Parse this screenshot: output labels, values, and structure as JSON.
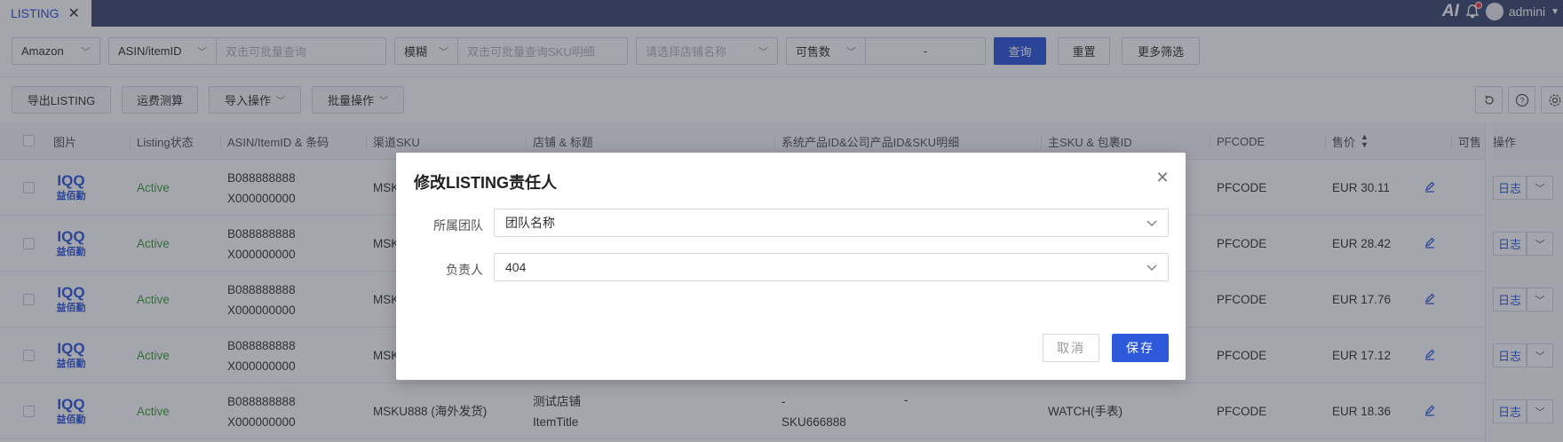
{
  "tabs": {
    "active_label": "LISTING",
    "close_glyph": "✕"
  },
  "header": {
    "ai_label": "AI",
    "username": "admini"
  },
  "filters": {
    "platform": "Amazon",
    "id_type": "ASIN/itemID",
    "id_placeholder": "双击可批量查询",
    "match_mode": "模糊",
    "sku_placeholder": "双击可批量查询SKU明细",
    "shop_placeholder": "请选择店铺名称",
    "qty_type": "可售数",
    "range_sep": "-",
    "search_btn": "查询",
    "reset_btn": "重置",
    "more_btn": "更多筛选"
  },
  "actions": {
    "export": "导出LISTING",
    "freight": "运费测算",
    "import": "导入操作",
    "batch": "批量操作"
  },
  "table": {
    "columns": {
      "image": "图片",
      "status": "Listing状态",
      "asin": "ASIN/ItemID & 条码",
      "sku": "渠道SKU",
      "shop": "店铺 & 标题",
      "sysid": "系统产品ID&公司产品ID&SKU明细",
      "mainsku": "主SKU & 包裹ID",
      "pfcode": "PFCODE",
      "price": "售价",
      "sellable": "可售",
      "ops": "操作"
    },
    "logo_text": "益佰勤",
    "log_label": "日志",
    "rows": [
      {
        "status": "Active",
        "asin": "B088888888",
        "barcode": "X000000000",
        "sku": "MSK",
        "pfcode": "PFCODE",
        "price": "EUR 30.11"
      },
      {
        "status": "Active",
        "asin": "B088888888",
        "barcode": "X000000000",
        "sku": "MSK",
        "pfcode": "PFCODE",
        "price": "EUR 28.42"
      },
      {
        "status": "Active",
        "asin": "B088888888",
        "barcode": "X000000000",
        "sku": "MSK",
        "pfcode": "PFCODE",
        "price": "EUR 17.76"
      },
      {
        "status": "Active",
        "asin": "B088888888",
        "barcode": "X000000000",
        "sku": "MSK",
        "pfcode": "PFCODE",
        "price": "EUR 17.12"
      },
      {
        "status": "Active",
        "asin": "B088888888",
        "barcode": "X000000000",
        "sku": "MSKU888 (海外发货)",
        "shop": "测试店铺",
        "title": "ItemTitle",
        "sys1": "-",
        "sys2": "-",
        "sys3": "SKU666888",
        "mainsku": "WATCH(手表)",
        "pfcode": "PFCODE",
        "price": "EUR 18.36"
      }
    ]
  },
  "modal": {
    "title": "修改LISTING责任人",
    "team_label": "所属团队",
    "team_value": "团队名称",
    "owner_label": "负责人",
    "owner_value": "404",
    "cancel": "取消",
    "save": "保存"
  },
  "colors": {
    "primary": "#2b59d9",
    "active_status": "#3f9d38",
    "topbar": "#3c4a6e"
  }
}
